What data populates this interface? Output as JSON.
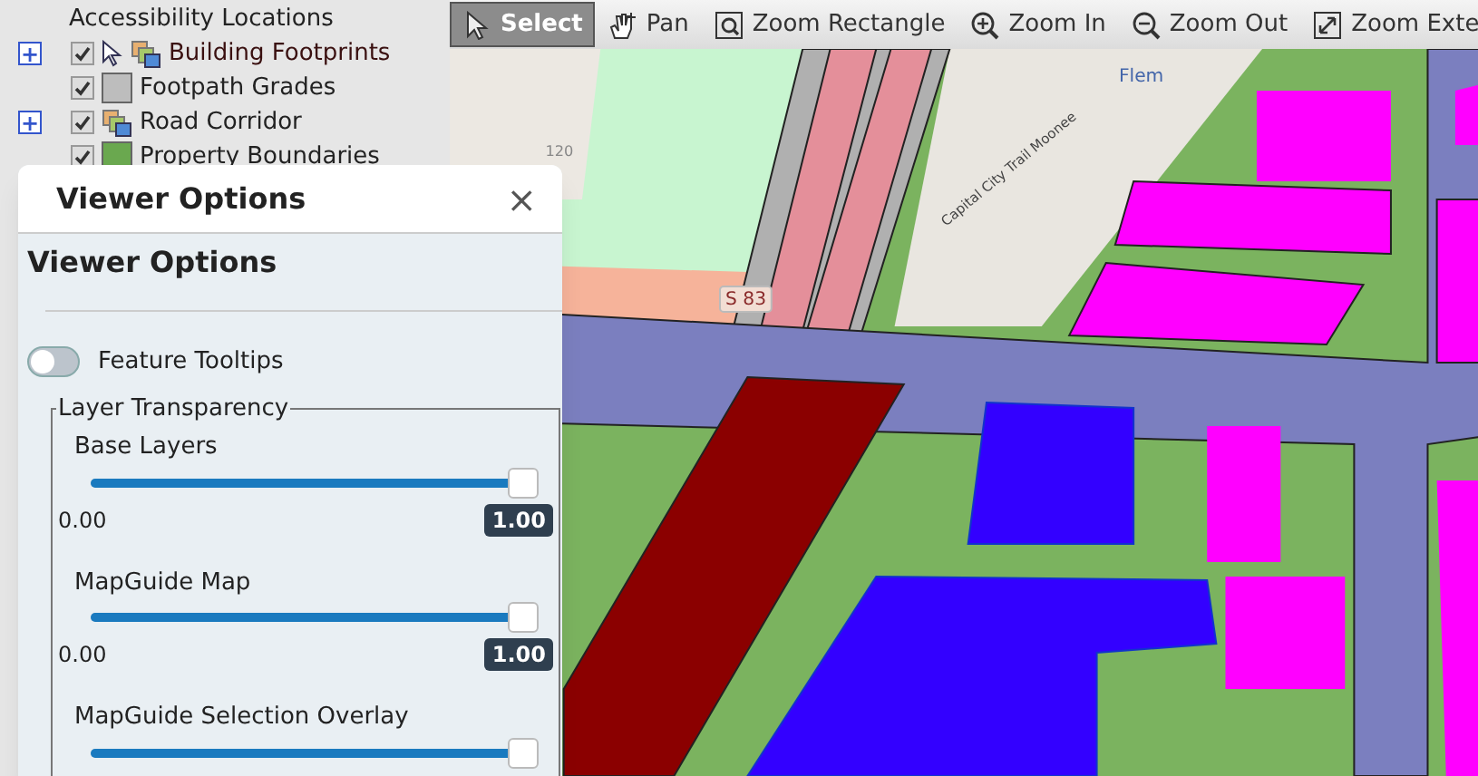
{
  "layer_tree": [
    {
      "label": "Accessibility Locations",
      "kind": "text"
    },
    {
      "label": "Building Footprints",
      "kind": "group",
      "expand": "+",
      "checked": true,
      "selectable": true
    },
    {
      "label": "Footpath Grades",
      "kind": "swatch",
      "color": "#bdbdbd",
      "checked": true
    },
    {
      "label": "Road Corridor",
      "kind": "group",
      "expand": "+",
      "checked": true
    },
    {
      "label": "Property Boundaries",
      "kind": "swatch",
      "color": "#6aa84f",
      "checked": true
    }
  ],
  "toolbar": [
    {
      "label": "Select",
      "selected": true
    },
    {
      "label": "Pan",
      "selected": false
    },
    {
      "label": "Zoom Rectangle",
      "selected": false
    },
    {
      "label": "Zoom In",
      "selected": false
    },
    {
      "label": "Zoom Out",
      "selected": false
    },
    {
      "label": "Zoom Exte",
      "selected": false
    }
  ],
  "map": {
    "labels": [
      {
        "text": "S 83",
        "kind": "shield"
      },
      {
        "text": "Capital City Trail Moonee",
        "kind": "trail"
      },
      {
        "text": "Flem",
        "kind": "street"
      },
      {
        "text": "120",
        "kind": "number"
      }
    ]
  },
  "dialog": {
    "title": "Viewer Options",
    "close": "×",
    "heading": "Viewer Options",
    "toggle": {
      "label": "Feature Tooltips",
      "on": false
    },
    "fieldset": {
      "legend": "Layer Transparency",
      "sliders": [
        {
          "name": "Base Layers",
          "level": 1,
          "min": "0.00",
          "value": "1.00"
        },
        {
          "name": "MapGuide Map",
          "level": 1,
          "min": "0.00",
          "value": "1.00"
        },
        {
          "name": "MapGuide Selection Overlay",
          "level": 1
        }
      ]
    }
  }
}
